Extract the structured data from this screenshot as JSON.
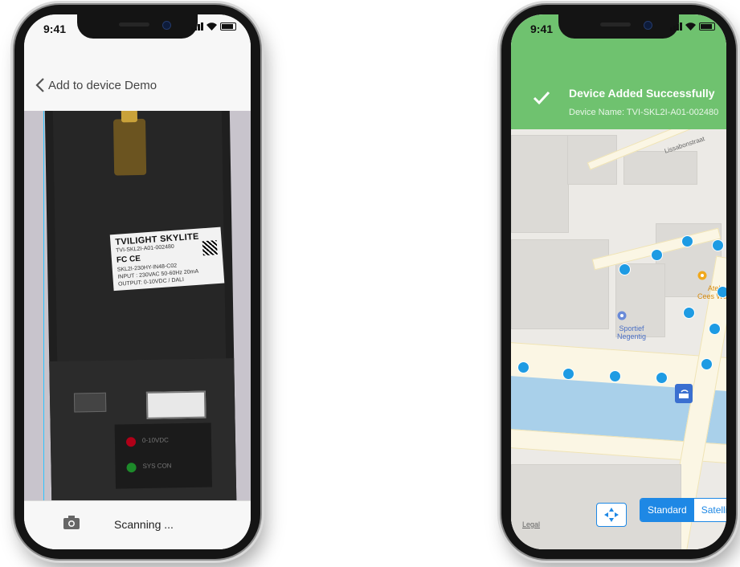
{
  "left_phone": {
    "status_time": "9:41",
    "nav": {
      "back_label": "Add to device Demo"
    },
    "camera_view": {
      "label": {
        "title": "TVILIGHT SKYLITE",
        "serial": "TVI-SKL2I-A01-002480",
        "marks": "FC CE",
        "model": "SKL2I-230HY-IN48-C02",
        "input": "INPUT : 230VAC 50-60Hz 20mA",
        "output": "OUTPUT: 0-10VDC / DALI"
      },
      "led_labels": [
        "0-10VDC",
        "SYS CON"
      ]
    },
    "bottom": {
      "scan_text": "Scanning ...",
      "camera_icon": "camera-icon"
    }
  },
  "right_phone": {
    "status_time": "9:41",
    "banner": {
      "title": "Device Added Successfully",
      "subtitle": "Device Name: TVI-SKL2I-A01-002480"
    },
    "map": {
      "street": "Lissabonstraat",
      "poi_1": "Sportief\nNegentig",
      "poi_2": "Atel\nCees Wolf",
      "legal": "Legal",
      "dot_color": "#1e9be3",
      "controls": {
        "standard": "Standard",
        "satellite": "Satellite",
        "locate_icon": "crosshair-icon"
      }
    }
  },
  "colors": {
    "accent": "#1e88e5",
    "success": "#6fc26f",
    "scanline": "#2ec4ff"
  }
}
